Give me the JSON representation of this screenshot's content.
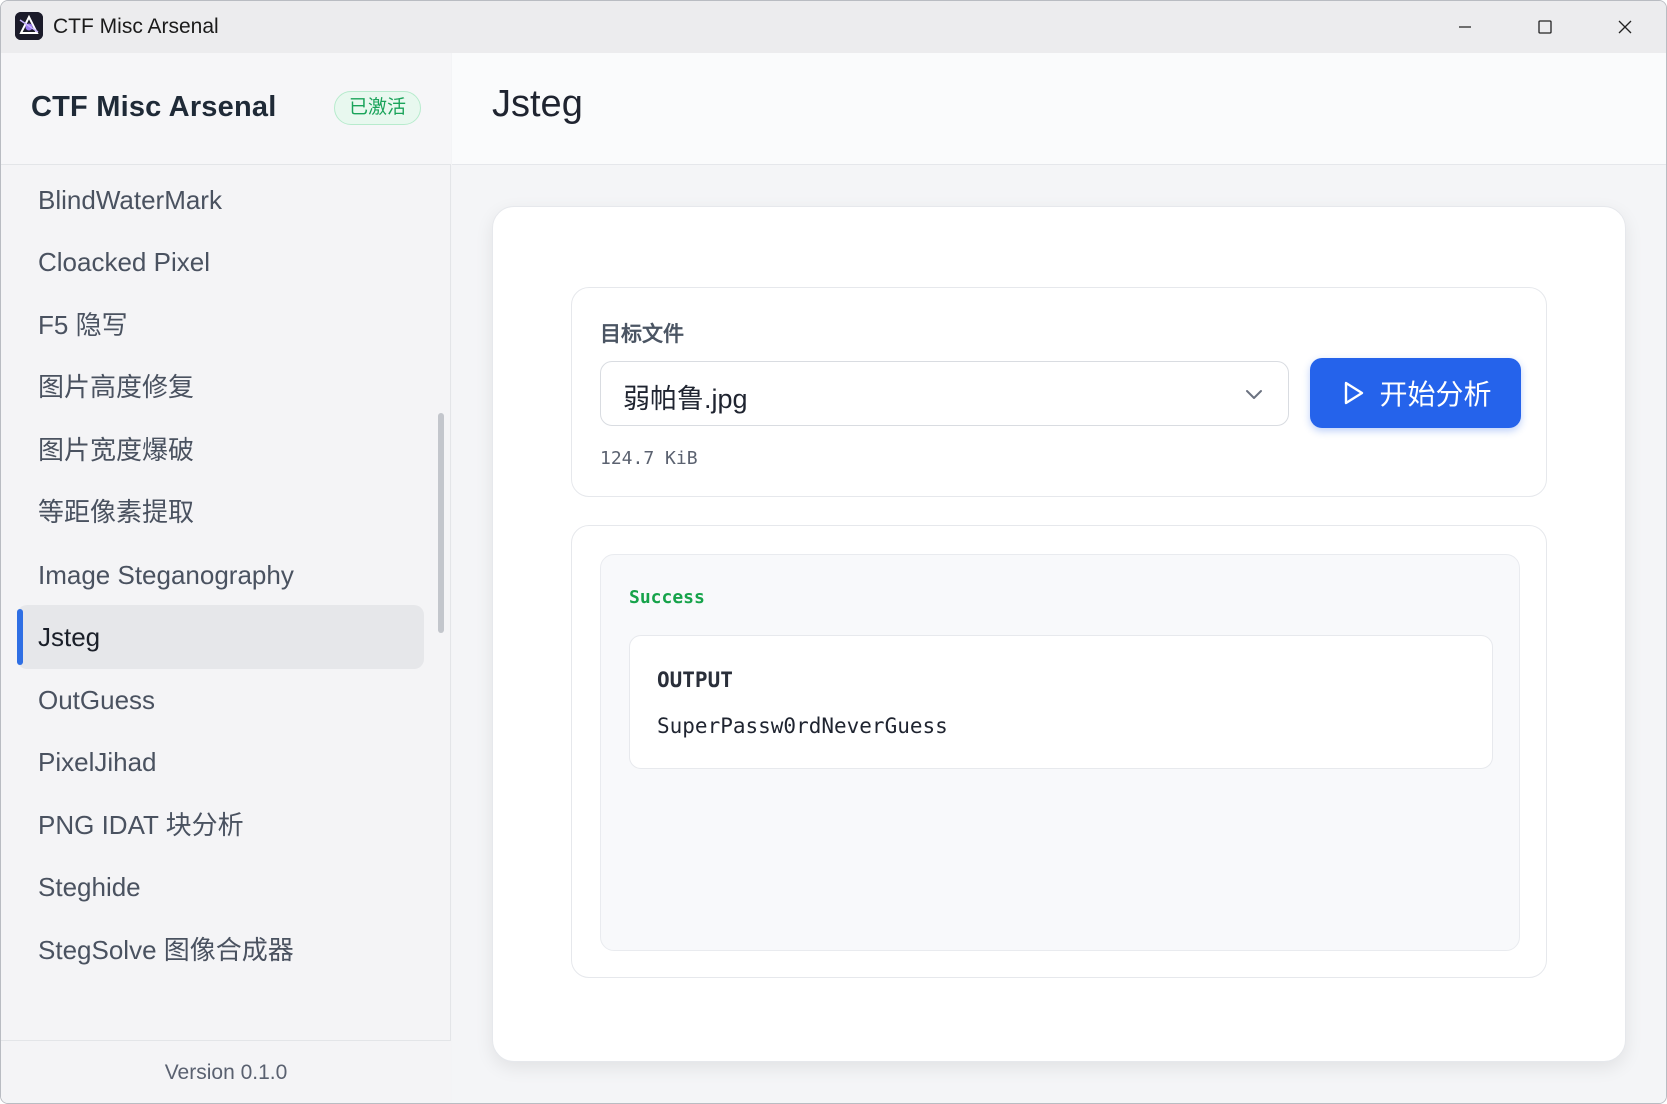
{
  "window": {
    "title": "CTF Misc Arsenal",
    "icon": "app-logo-icon"
  },
  "sidebar": {
    "title": "CTF Misc Arsenal",
    "badge": "已激活",
    "items": [
      {
        "label": "BlindWaterMark"
      },
      {
        "label": "Cloacked Pixel"
      },
      {
        "label": "F5 隐写"
      },
      {
        "label": "图片高度修复"
      },
      {
        "label": "图片宽度爆破"
      },
      {
        "label": "等距像素提取"
      },
      {
        "label": "Image Steganography"
      },
      {
        "label": "Jsteg",
        "active": true
      },
      {
        "label": "OutGuess"
      },
      {
        "label": "PixelJihad"
      },
      {
        "label": "PNG IDAT 块分析"
      },
      {
        "label": "Steghide"
      },
      {
        "label": "StegSolve 图像合成器"
      }
    ],
    "version": "Version 0.1.0"
  },
  "main": {
    "page_title": "Jsteg",
    "file_panel": {
      "label": "目标文件",
      "selected_file": "弱帕鲁.jpg",
      "file_size": "124.7 KiB",
      "analyze_button": "开始分析"
    },
    "result": {
      "status": "Success",
      "output_label": "OUTPUT",
      "output_value": "SuperPassw0rdNeverGuess"
    }
  },
  "colors": {
    "accent": "#2563eb",
    "success": "#16a34a",
    "badge_bg": "#e8f8ef"
  }
}
